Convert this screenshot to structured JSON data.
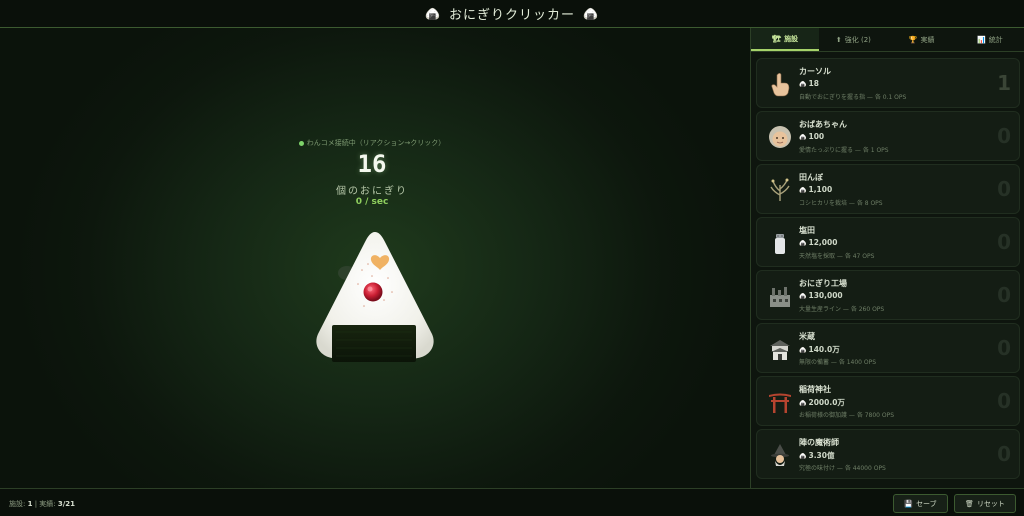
{
  "app": {
    "title": "おにぎりクリッカー",
    "title_icon_left": "🍙",
    "title_icon_right": "🍙"
  },
  "game": {
    "combo_text": "わんコメ接続中（リアクション→クリック）",
    "count": "16",
    "count_unit": "個のおにぎり",
    "rate": "0 / sec"
  },
  "tabs": [
    {
      "icon": "🏗",
      "label": "施設",
      "icon_name": "building-icon"
    },
    {
      "icon": "⬆",
      "label": "強化 (2)",
      "icon_name": "upgrade-icon"
    },
    {
      "icon": "🏆",
      "label": "実績",
      "icon_name": "trophy-icon"
    },
    {
      "icon": "📊",
      "label": "統計",
      "icon_name": "chart-icon"
    }
  ],
  "buildings": [
    {
      "name": "カーソル",
      "cost": "18",
      "desc": "自動でおにぎりを握る指 — 各 0.1 OPS",
      "owned": "1",
      "icon": "👆",
      "icon_name": "pointing-hand-icon"
    },
    {
      "name": "おばあちゃん",
      "cost": "100",
      "desc": "愛情たっぷりに握る — 各 1 OPS",
      "owned": "0",
      "icon": "👵",
      "icon_name": "grandma-icon"
    },
    {
      "name": "田んぼ",
      "cost": "1,100",
      "desc": "コシヒカリを栽培 — 各 8 OPS",
      "owned": "0",
      "icon": "🌾",
      "icon_name": "rice-plant-icon"
    },
    {
      "name": "塩田",
      "cost": "12,000",
      "desc": "天然塩を採取 — 各 47 OPS",
      "owned": "0",
      "icon": "🧂",
      "icon_name": "salt-icon"
    },
    {
      "name": "おにぎり工場",
      "cost": "130,000",
      "desc": "大量生産ライン — 各 260 OPS",
      "owned": "0",
      "icon": "🏭",
      "icon_name": "factory-icon"
    },
    {
      "name": "米蔵",
      "cost": "140.0万",
      "desc": "無限の備蓄 — 各 1400 OPS",
      "owned": "0",
      "icon": "🏯",
      "icon_name": "storehouse-icon"
    },
    {
      "name": "稲荷神社",
      "cost": "2000.0万",
      "desc": "お稲荷様の御加護 — 各 7800 OPS",
      "owned": "0",
      "icon": "⛩",
      "icon_name": "shrine-icon"
    },
    {
      "name": "陣の魔術師",
      "cost": "3.30億",
      "desc": "究極の味付け — 各 44000 OPS",
      "owned": "0",
      "icon": "🧙",
      "icon_name": "wizard-icon"
    }
  ],
  "footer": {
    "buildings_label": "施設: ",
    "buildings_value": "1",
    "sep": " | ",
    "achievements_label": "実績: ",
    "achievements_value": "3/21",
    "save_icon": "💾",
    "save_label": "セーブ",
    "reset_icon": "🗑",
    "reset_label": "リセット"
  },
  "colors": {
    "accent": "#a6d36a",
    "background": "#0d140d",
    "rate": "#8fcf5e"
  }
}
